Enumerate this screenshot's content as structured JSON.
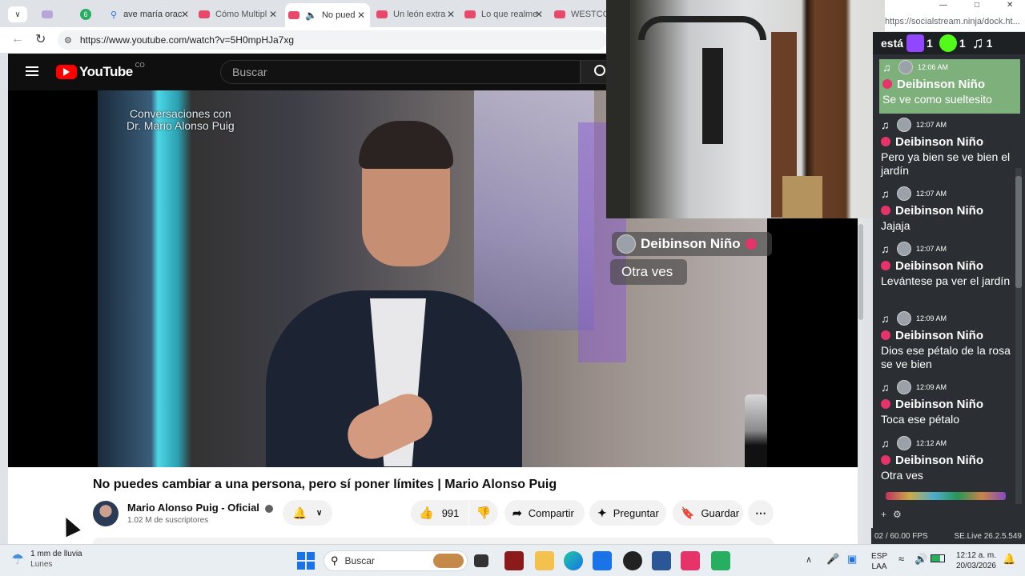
{
  "browser": {
    "tabs": [
      {
        "label": "",
        "color": "#b8a6d9"
      },
      {
        "label": "6",
        "color": "#27ae60"
      },
      {
        "label": "ave maría orac",
        "color": "#1a73e8"
      },
      {
        "label": "Cómo Multipl",
        "color": "#e8496b"
      },
      {
        "label": "No pued",
        "color": "#e8496b"
      },
      {
        "label": "Un león extra",
        "color": "#e8496b"
      },
      {
        "label": "Lo que realme",
        "color": "#e8496b"
      },
      {
        "label": "WESTCOL",
        "color": "#e8496b"
      }
    ],
    "url": "https://www.youtube.com/watch?v=5H0mpHJa7xg"
  },
  "youtube": {
    "logo_text": "YouTube",
    "region": "CO",
    "search_placeholder": "Buscar",
    "video_overlay_line1": "Conversaciones con",
    "video_overlay_line2": "Dr. Mario Alonso Puig",
    "title": "No puedes cambiar a una persona, pero sí poner límites | Mario Alonso Puig",
    "channel": "Mario Alonso Puig - Oficial",
    "subscribers": "1.02 M de suscriptores",
    "likes": "991",
    "share_label": "Compartir",
    "ask_label": "Preguntar",
    "save_label": "Guardar"
  },
  "bubble": {
    "name": "Deibinson Niño",
    "text": "Otra ves"
  },
  "socialstream": {
    "url": "https://socialstream.ninja/dock.ht...",
    "header_text": "está",
    "counts": {
      "twitch": "1",
      "kick": "1",
      "tiktok": "1"
    },
    "messages": [
      {
        "time": "12:06 AM",
        "name": "Deibinson Niño",
        "text": "Se ve como sueltesito",
        "highlight": true
      },
      {
        "time": "12:07 AM",
        "name": "Deibinson Niño",
        "text": "Pero ya bien se ve bien el jardín"
      },
      {
        "time": "12:07 AM",
        "name": "Deibinson Niño",
        "text": "Jajaja"
      },
      {
        "time": "12:07 AM",
        "name": "Deibinson Niño",
        "text": "Levántese pa ver el jardín"
      },
      {
        "time": "12:09 AM",
        "name": "Deibinson Niño",
        "text": "Dios ese pétalo de la rosa se ve bien"
      },
      {
        "time": "12:09 AM",
        "name": "Deibinson Niño",
        "text": "Toca ese pétalo"
      },
      {
        "time": "12:12 AM",
        "name": "Deibinson Niño",
        "text": "Otra ves"
      }
    ],
    "fps": "02 / 60.00 FPS",
    "version": "SE.Live 26.2.5.549"
  },
  "taskbar": {
    "weather_line1": "1 mm de lluvia",
    "weather_line2": "Lunes",
    "search_placeholder": "Buscar",
    "lang1": "ESP",
    "lang2": "LAA",
    "time": "12:12 a. m.",
    "date": "20/03/2026"
  }
}
